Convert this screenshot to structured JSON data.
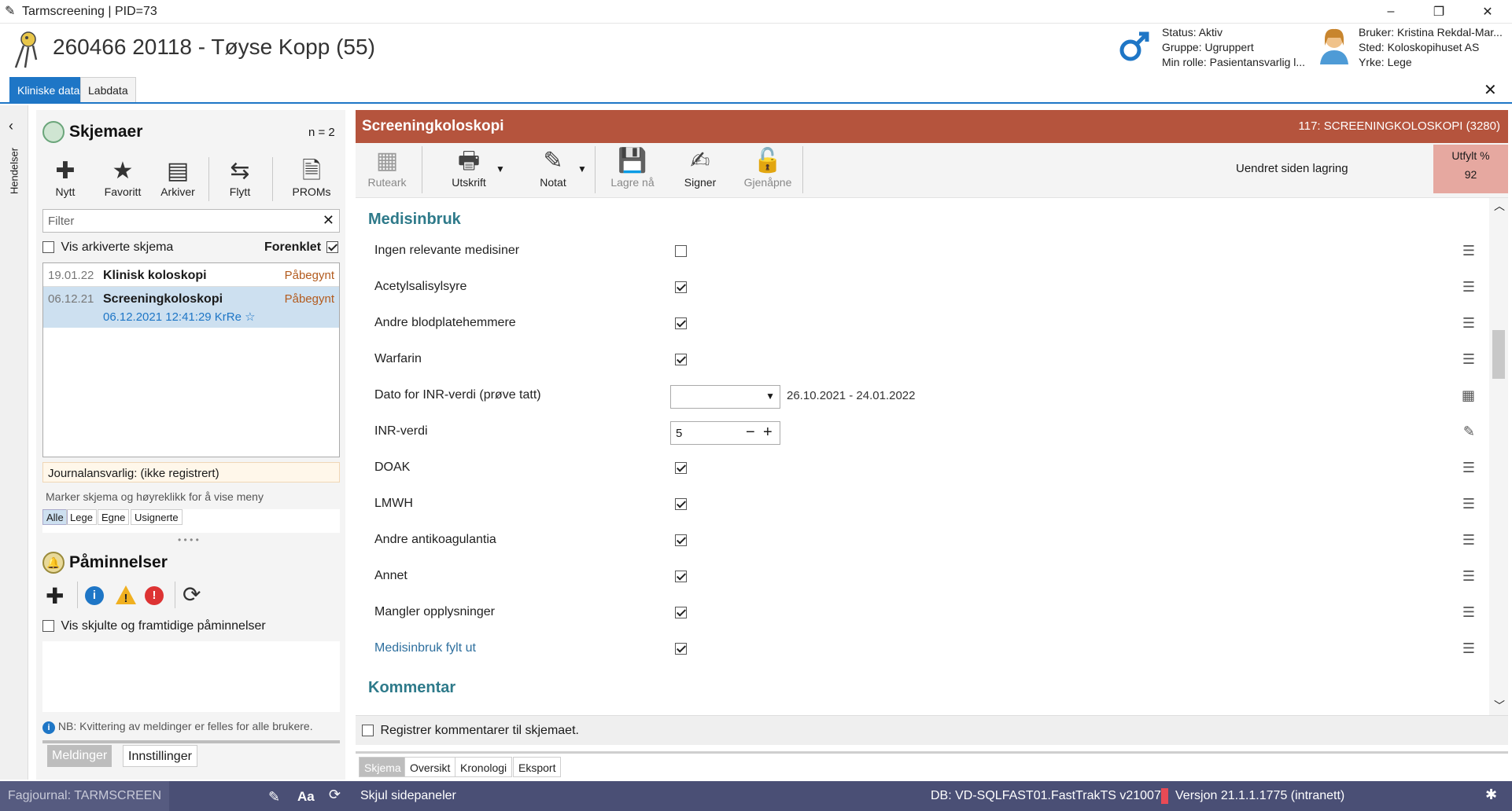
{
  "window": {
    "title": "Tarmscreening | PID=73",
    "controls": [
      "–",
      "❐",
      "✕"
    ]
  },
  "patient": {
    "title": "260466 20118 - Tøyse Kopp (55)",
    "status": "Status: Aktiv",
    "group": "Gruppe: Ugruppert",
    "role": "Min rolle: Pasientansvarlig l...",
    "user": "Bruker: Kristina Rekdal-Mar...",
    "place": "Sted: Koloskopihuset AS",
    "profession": "Yrke: Lege"
  },
  "tabs": [
    {
      "label": "Kliniske data",
      "active": true
    },
    {
      "label": "Labdata",
      "active": false
    }
  ],
  "sidestrip": {
    "label": "Hendelser"
  },
  "skjemaer": {
    "title": "Skjemaer",
    "count": "n = 2",
    "toolbar": [
      "Nytt",
      "Favoritt",
      "Arkiver",
      "Flytt",
      "PROMs"
    ],
    "filter_placeholder": "Filter",
    "show_archived": "Vis arkiverte skjema",
    "simplified": "Forenklet",
    "forms": [
      {
        "date": "19.01.22",
        "name": "Klinisk koloskopi",
        "status": "Påbegynt",
        "sub": ""
      },
      {
        "date": "06.12.21",
        "name": "Screeningkoloskopi",
        "status": "Påbegynt",
        "sub": "06.12.2021 12:41:29 KrRe ☆"
      }
    ],
    "journal": "Journalansvarlig: (ikke registrert)",
    "hint": "Marker skjema og høyreklikk for å vise meny",
    "filters": [
      "Alle",
      "Lege",
      "Egne",
      "Usignerte"
    ]
  },
  "reminders": {
    "title": "Påminnelser",
    "show_hidden": "Vis skjulte og framtidige påminnelser",
    "note": "NB: Kvittering av meldinger er felles for alle brukere.",
    "tabs": [
      "Meldinger",
      "Innstillinger"
    ]
  },
  "form": {
    "title": "Screeningkoloskopi",
    "code": "117: SCREENINGKOLOSKOPI (3280)",
    "toolbar": [
      "Ruteark",
      "Utskrift",
      "Notat",
      "Lagre nå",
      "Signer",
      "Gjenåpne"
    ],
    "changed": "Uendret siden lagring",
    "filled_label": "Utfylt %",
    "filled_value": "92",
    "group1": "Medisinbruk",
    "rows": [
      {
        "label": "Ingen relevante medisiner",
        "checked": false
      },
      {
        "label": "Acetylsalisylsyre",
        "checked": true
      },
      {
        "label": "Andre blodplatehemmere",
        "checked": true
      },
      {
        "label": "Warfarin",
        "checked": true
      },
      {
        "label": "Dato for INR-verdi (prøve tatt)",
        "range": "26.10.2021 - 24.01.2022"
      },
      {
        "label": "INR-verdi",
        "value": "5"
      },
      {
        "label": "DOAK",
        "checked": true
      },
      {
        "label": "LMWH",
        "checked": true
      },
      {
        "label": "Andre antikoagulantia",
        "checked": true
      },
      {
        "label": "Annet",
        "checked": true
      },
      {
        "label": "Mangler opplysninger",
        "checked": true
      },
      {
        "label": "Medisinbruk fylt ut",
        "checked": true
      }
    ],
    "group2": "Kommentar",
    "register_comments": "Registrer kommentarer til skjemaet.",
    "bottom_tabs": [
      "Skjema",
      "Oversikt",
      "Kronologi",
      "Eksport"
    ]
  },
  "statusbar": {
    "journal": "Fagjournal: TARMSCREEN",
    "hide_panels": "Skjul sidepaneler",
    "db": "DB: VD-SQLFAST01.FastTrakTS v21007",
    "version": "Versjon 21.1.1.1775 (intranett)"
  },
  "colors": {
    "accent": "#1e76c6",
    "header_bar": "#b5543d",
    "status_bar": "#4a4f75",
    "group_heading": "#2e7a8a",
    "progress_bg": "#e6a8a0"
  }
}
